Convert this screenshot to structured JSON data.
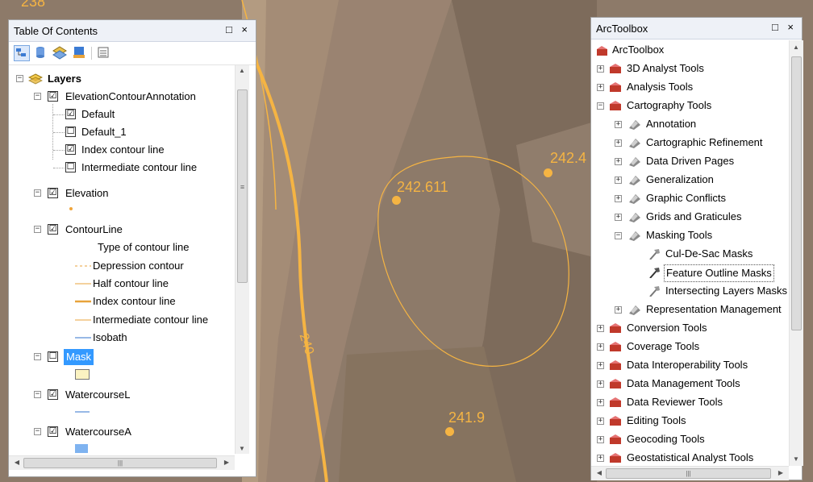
{
  "map": {
    "labels": {
      "top_left": "238",
      "point_1": "242.611",
      "point_2": "242.4",
      "point_3": "241.9",
      "contour": "240"
    }
  },
  "toc": {
    "title": "Table Of Contents",
    "controls": "□ ×",
    "toolbar_icons": [
      "list-by-drawing-order-icon",
      "list-by-source-icon",
      "list-by-visibility-icon",
      "list-by-selection-icon",
      "options-icon"
    ],
    "root": "Layers",
    "items": [
      {
        "label": "ElevationContourAnnotation",
        "checked": "☑"
      },
      {
        "label": "Default",
        "checked": "☑"
      },
      {
        "label": "Default_1",
        "checked": "☐"
      },
      {
        "label": "Index contour line",
        "checked": "☑"
      },
      {
        "label": "Intermediate contour line",
        "checked": "☐"
      },
      {
        "label": "Elevation",
        "checked": "☑"
      },
      {
        "label": "ContourLine",
        "checked": "☑"
      },
      {
        "label": "Type of contour line"
      },
      {
        "label": "Depression contour"
      },
      {
        "label": "Half contour line"
      },
      {
        "label": "Index contour line"
      },
      {
        "label": "Intermediate contour line"
      },
      {
        "label": "Isobath"
      },
      {
        "label": "Mask",
        "checked": "☐",
        "selected": "true"
      },
      {
        "label": "WatercourseL",
        "checked": "☑"
      },
      {
        "label": "WatercourseA",
        "checked": "☑"
      }
    ],
    "scroll_thumb_glyph": "≡",
    "hscroll_thumb_glyph": "|||"
  },
  "toolbox": {
    "title": "ArcToolbox",
    "controls": "□ ×",
    "root": "ArcToolbox",
    "items": [
      "3D Analyst Tools",
      "Analysis Tools",
      "Cartography Tools",
      "Annotation",
      "Cartographic Refinement",
      "Data Driven Pages",
      "Generalization",
      "Graphic Conflicts",
      "Grids and Graticules",
      "Masking Tools",
      "Cul-De-Sac Masks",
      "Feature Outline Masks",
      "Intersecting Layers Masks",
      "Representation Management",
      "Conversion Tools",
      "Coverage Tools",
      "Data Interoperability Tools",
      "Data Management Tools",
      "Data Reviewer Tools",
      "Editing Tools",
      "Geocoding Tools",
      "Geostatistical Analyst Tools"
    ],
    "hscroll_thumb_glyph": "|||"
  },
  "colors": {
    "map_bg": "#8a7766",
    "contour": "#f5b443",
    "selection": "#3399ff",
    "toolbox_red": "#c0392b"
  }
}
